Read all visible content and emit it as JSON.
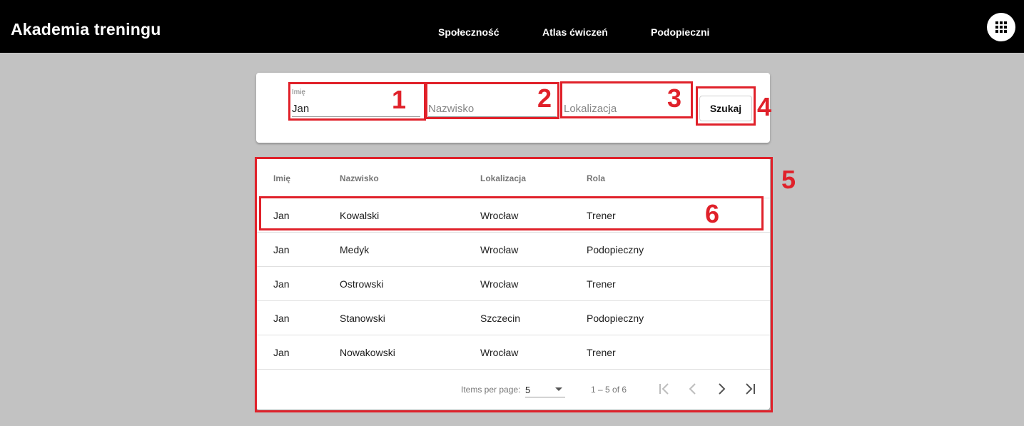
{
  "app": {
    "title": "Akademia treningu",
    "nav": [
      {
        "label": "Społeczność"
      },
      {
        "label": "Atlas ćwiczeń"
      },
      {
        "label": "Podopieczni"
      }
    ],
    "apps_icon": "apps-grid-icon"
  },
  "search": {
    "first_name": {
      "label": "Imię",
      "value": "Jan"
    },
    "last_name": {
      "placeholder": "Nazwisko",
      "value": ""
    },
    "location": {
      "placeholder": "Lokalizacja",
      "value": ""
    },
    "button_label": "Szukaj"
  },
  "table": {
    "columns": [
      "Imię",
      "Nazwisko",
      "Lokalizacja",
      "Rola"
    ],
    "rows": [
      [
        "Jan",
        "Kowalski",
        "Wrocław",
        "Trener"
      ],
      [
        "Jan",
        "Medyk",
        "Wrocław",
        "Podopieczny"
      ],
      [
        "Jan",
        "Ostrowski",
        "Wrocław",
        "Trener"
      ],
      [
        "Jan",
        "Stanowski",
        "Szczecin",
        "Podopieczny"
      ],
      [
        "Jan",
        "Nowakowski",
        "Wrocław",
        "Trener"
      ]
    ]
  },
  "paginator": {
    "items_per_page_label": "Items per page:",
    "items_per_page": "5",
    "range": "1 – 5 of 6",
    "icons": [
      "first-page-icon",
      "previous-page-icon",
      "next-page-icon",
      "last-page-icon"
    ]
  },
  "annotations": {
    "color": "#e0212a",
    "labels": [
      "1",
      "2",
      "3",
      "4",
      "5",
      "6"
    ]
  }
}
